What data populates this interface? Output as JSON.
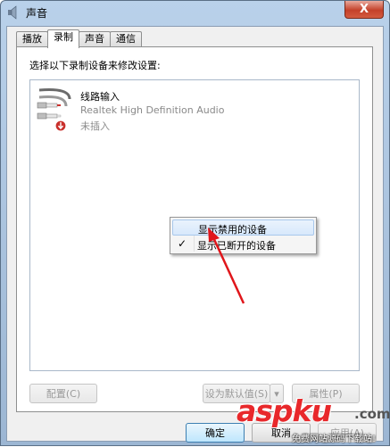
{
  "window": {
    "title": "声音",
    "close_glyph": "X"
  },
  "tabs": [
    {
      "label": "播放",
      "active": false
    },
    {
      "label": "录制",
      "active": true
    },
    {
      "label": "声音",
      "active": false
    },
    {
      "label": "通信",
      "active": false
    }
  ],
  "panel": {
    "instruction": "选择以下录制设备来修改设置:"
  },
  "device": {
    "name": "线路输入",
    "driver": "Realtek High Definition Audio",
    "status": "未插入",
    "icon": "line-in-jack-icon"
  },
  "context_menu": {
    "items": [
      {
        "label": "显示禁用的设备",
        "checked": false,
        "highlighted": true
      },
      {
        "label": "显示已断开的设备",
        "checked": true,
        "highlighted": false
      }
    ],
    "check_glyph": "✓"
  },
  "buttons": {
    "configure": "配置(C)",
    "set_default": "设为默认值(S)",
    "properties": "属性(P)",
    "ok": "确定",
    "cancel": "取消",
    "apply": "应用(A)"
  },
  "watermark": {
    "logo": "aspku",
    "domain": ".com",
    "subtitle": "免费网站源码下载站!"
  },
  "colors": {
    "arrow": "#e0161b",
    "highlight": "#d7e8fb",
    "watermark": "#e8282b"
  }
}
